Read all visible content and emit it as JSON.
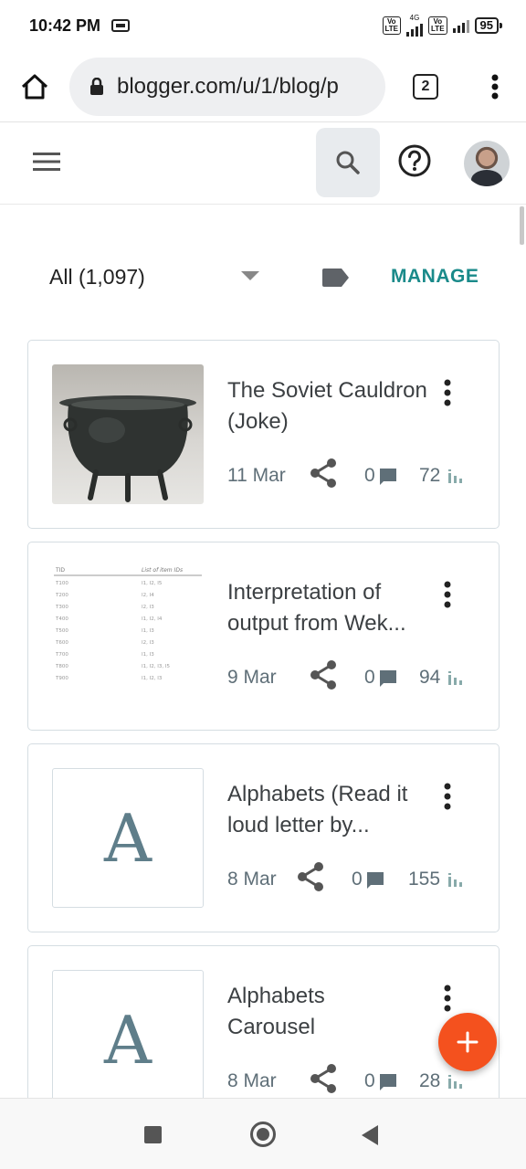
{
  "status_bar": {
    "time": "10:42 PM",
    "network_label": "4G",
    "volte_label_1": "Vo\nLTE",
    "volte_label_2": "Vo\nLTE",
    "battery": "95"
  },
  "browser": {
    "url": "blogger.com/u/1/blog/p",
    "tab_count": "2",
    "icons": {
      "home": "home-icon",
      "lock": "lock-icon",
      "menu": "more-vert-icon"
    }
  },
  "app_bar": {
    "icons": {
      "menu": "hamburger-icon",
      "search": "search-icon",
      "help": "help-icon",
      "avatar": "avatar"
    }
  },
  "filter": {
    "label": "All (1,097)",
    "manage_label": "MANAGE"
  },
  "posts": [
    {
      "title": "The Soviet Cauldron (Joke)",
      "date": "11 Mar",
      "comments": "0",
      "views": "72",
      "thumbnail": "photo"
    },
    {
      "title": "Interpretation of output from Wek...",
      "date": "9 Mar",
      "comments": "0",
      "views": "94",
      "thumbnail": "table"
    },
    {
      "title": "Alphabets (Read it loud letter by...",
      "date": "8 Mar",
      "comments": "0",
      "views": "155",
      "thumbnail": "letter",
      "letter": "A"
    },
    {
      "title": "Alphabets Carousel",
      "date": "8 Mar",
      "comments": "0",
      "views": "28",
      "thumbnail": "letter",
      "letter": "A"
    }
  ],
  "thumb_table": {
    "header": [
      "TID",
      "List of item IDs"
    ],
    "rows": [
      [
        "T100",
        "I1, I2, I5"
      ],
      [
        "T200",
        "I2, I4"
      ],
      [
        "T300",
        "I2, I3"
      ],
      [
        "T400",
        "I1, I2, I4"
      ],
      [
        "T500",
        "I1, I3"
      ],
      [
        "T600",
        "I2, I3"
      ],
      [
        "T700",
        "I1, I3"
      ],
      [
        "T800",
        "I1, I2, I3, I5"
      ],
      [
        "T900",
        "I1, I2, I3"
      ]
    ]
  },
  "fab": {
    "label": "+"
  },
  "colors": {
    "accent": "#1a8a8a",
    "fab": "#f4511e",
    "meta": "#5f6f78"
  }
}
